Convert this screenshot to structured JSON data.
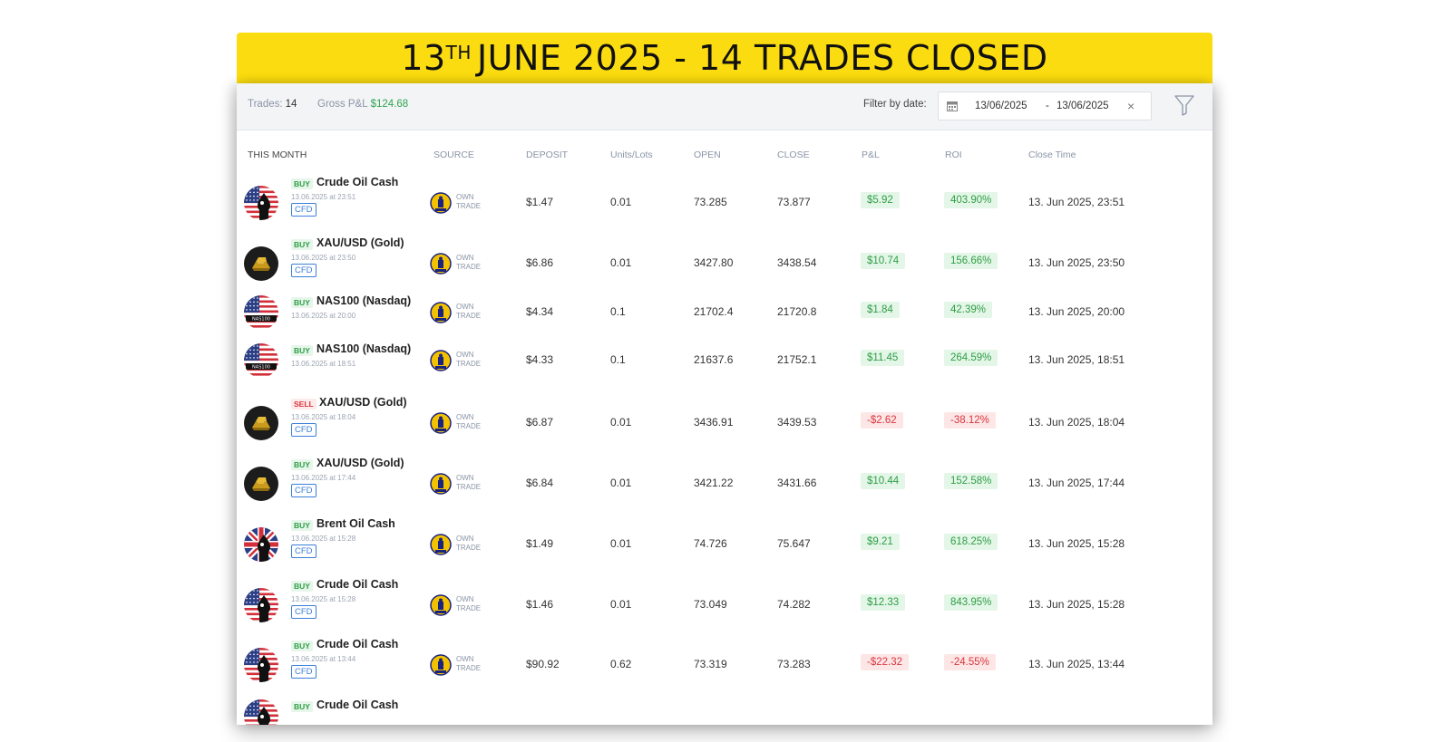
{
  "banner": {
    "day": "13",
    "day_suffix": "TH",
    "rest": "JUNE 2025 - 14 TRADES CLOSED"
  },
  "summary": {
    "trades_label": "Trades:",
    "trades_value": "14",
    "gross_label": "Gross P&L",
    "gross_value": "$124.68",
    "filter_label": "Filter by date:",
    "date_from": "13/06/2025",
    "date_sep": "-",
    "date_to": "13/06/2025",
    "clear_symbol": "×"
  },
  "columns": {
    "period": "THIS MONTH",
    "source": "SOURCE",
    "deposit": "DEPOSIT",
    "units": "Units/Lots",
    "open": "OPEN",
    "close": "CLOSE",
    "pnl": "P&L",
    "roi": "ROI",
    "close_time": "Close Time"
  },
  "source_text": {
    "line1": "OWN",
    "line2": "TRADE"
  },
  "badge_text": {
    "cfd": "CFD"
  },
  "colors": {
    "banner": "#fbdc10",
    "positive": "#2e9e45",
    "negative": "#d9363e",
    "accent": "#3b7fd8"
  },
  "trades": [
    {
      "icon": "us-flag-oil-icon",
      "side": "BUY",
      "instrument": "Crude Oil Cash",
      "opened": "13.06.2025 at 23:51",
      "cfd": true,
      "deposit": "$1.47",
      "units": "0.01",
      "open": "73.285",
      "close": "73.877",
      "pnl": "$5.92",
      "roi": "403.90%",
      "positive": true,
      "close_time": "13. Jun 2025, 23:51"
    },
    {
      "icon": "gold-bars-icon",
      "side": "BUY",
      "instrument": "XAU/USD (Gold)",
      "opened": "13.06.2025 at 23:50",
      "cfd": true,
      "deposit": "$6.86",
      "units": "0.01",
      "open": "3427.80",
      "close": "3438.54",
      "pnl": "$10.74",
      "roi": "156.66%",
      "positive": true,
      "close_time": "13. Jun 2025, 23:50"
    },
    {
      "icon": "us-flag-nas100-icon",
      "side": "BUY",
      "instrument": "NAS100 (Nasdaq)",
      "opened": "13.06.2025 at 20:00",
      "cfd": false,
      "deposit": "$4.34",
      "units": "0.1",
      "open": "21702.4",
      "close": "21720.8",
      "pnl": "$1.84",
      "roi": "42.39%",
      "positive": true,
      "close_time": "13. Jun 2025, 20:00"
    },
    {
      "icon": "us-flag-nas100-icon",
      "side": "BUY",
      "instrument": "NAS100 (Nasdaq)",
      "opened": "13.06.2025 at 18:51",
      "cfd": false,
      "deposit": "$4.33",
      "units": "0.1",
      "open": "21637.6",
      "close": "21752.1",
      "pnl": "$11.45",
      "roi": "264.59%",
      "positive": true,
      "close_time": "13. Jun 2025, 18:51"
    },
    {
      "icon": "gold-bars-icon",
      "side": "SELL",
      "instrument": "XAU/USD (Gold)",
      "opened": "13.06.2025 at 18:04",
      "cfd": true,
      "deposit": "$6.87",
      "units": "0.01",
      "open": "3436.91",
      "close": "3439.53",
      "pnl": "-$2.62",
      "roi": "-38.12%",
      "positive": false,
      "close_time": "13. Jun 2025, 18:04"
    },
    {
      "icon": "gold-bars-icon",
      "side": "BUY",
      "instrument": "XAU/USD (Gold)",
      "opened": "13.06.2025 at 17:44",
      "cfd": true,
      "deposit": "$6.84",
      "units": "0.01",
      "open": "3421.22",
      "close": "3431.66",
      "pnl": "$10.44",
      "roi": "152.58%",
      "positive": true,
      "close_time": "13. Jun 2025, 17:44"
    },
    {
      "icon": "uk-flag-oil-icon",
      "side": "BUY",
      "instrument": "Brent Oil Cash",
      "opened": "13.06.2025 at 15:28",
      "cfd": true,
      "deposit": "$1.49",
      "units": "0.01",
      "open": "74.726",
      "close": "75.647",
      "pnl": "$9.21",
      "roi": "618.25%",
      "positive": true,
      "close_time": "13. Jun 2025, 15:28"
    },
    {
      "icon": "us-flag-oil-icon",
      "side": "BUY",
      "instrument": "Crude Oil Cash",
      "opened": "13.06.2025 at 15:28",
      "cfd": true,
      "deposit": "$1.46",
      "units": "0.01",
      "open": "73.049",
      "close": "74.282",
      "pnl": "$12.33",
      "roi": "843.95%",
      "positive": true,
      "close_time": "13. Jun 2025, 15:28"
    },
    {
      "icon": "us-flag-oil-icon",
      "side": "BUY",
      "instrument": "Crude Oil Cash",
      "opened": "13.06.2025 at 13:44",
      "cfd": true,
      "deposit": "$90.92",
      "units": "0.62",
      "open": "73.319",
      "close": "73.283",
      "pnl": "-$22.32",
      "roi": "-24.55%",
      "positive": false,
      "close_time": "13. Jun 2025, 13:44"
    },
    {
      "icon": "us-flag-oil-icon",
      "side": "BUY",
      "instrument": "Crude Oil Cash",
      "opened": "",
      "cfd": false,
      "deposit": "",
      "units": "",
      "open": "",
      "close": "",
      "pnl": "",
      "roi": "",
      "positive": true,
      "close_time": ""
    }
  ]
}
